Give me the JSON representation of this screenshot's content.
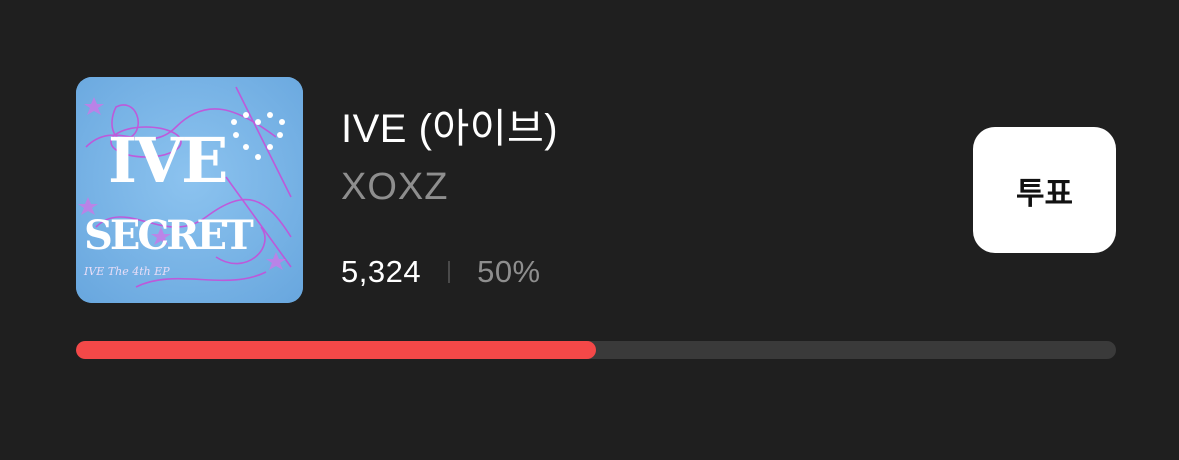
{
  "song": {
    "title": "IVE (아이브)",
    "album": "XOXZ",
    "album_art_text": [
      "IVE",
      "SECRET",
      "IVE The 4th EP"
    ]
  },
  "stats": {
    "votes": "5,324",
    "percent": "50%"
  },
  "vote_button": {
    "label": "투표"
  },
  "progress": {
    "fraction": 0.5
  },
  "colors": {
    "background": "#1f1f1f",
    "progress_fill": "#f44848",
    "progress_track": "#3a3a3a",
    "album_art_bg": "#79b5e8",
    "album_art_accent": "#d34ce0"
  }
}
